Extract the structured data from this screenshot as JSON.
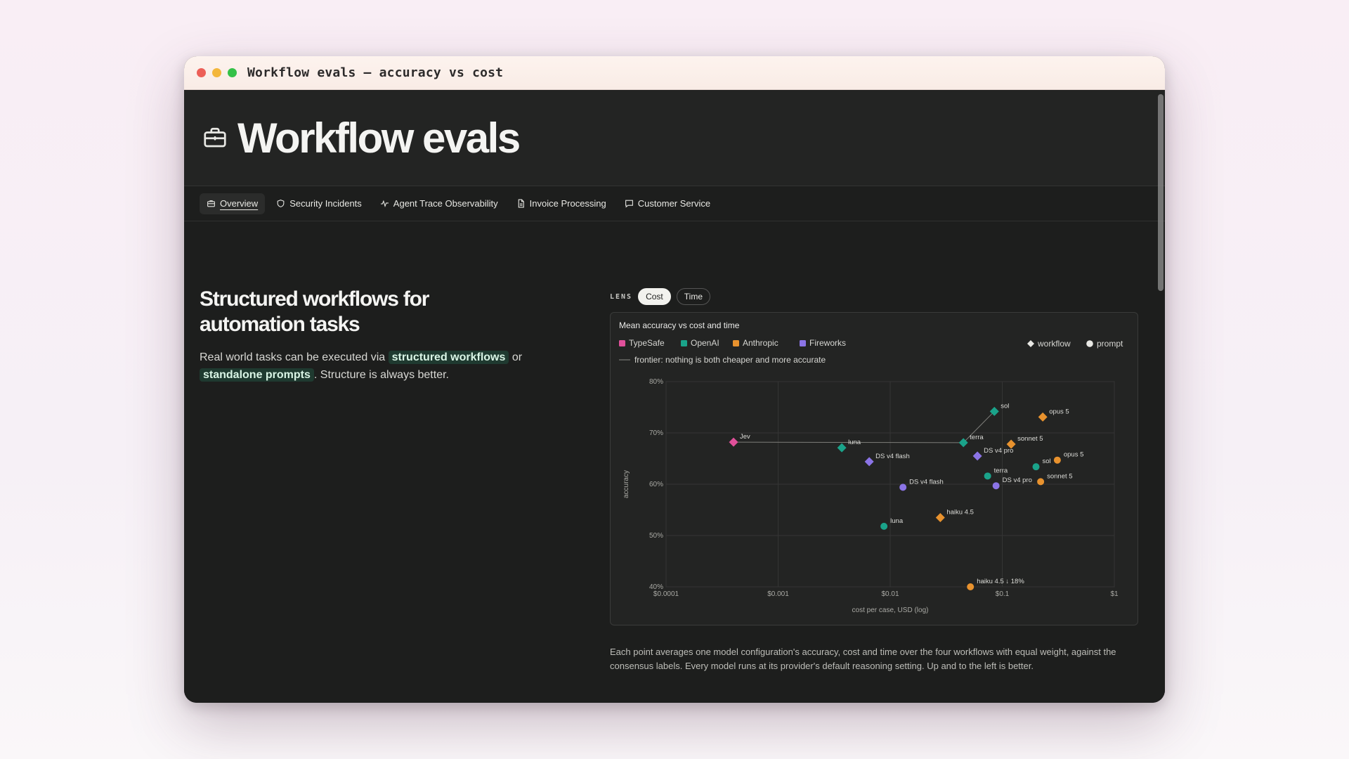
{
  "window": {
    "title": "Workflow evals — accuracy vs cost"
  },
  "header": {
    "title": "Workflow evals"
  },
  "tabs": [
    {
      "label": "Overview",
      "icon": "briefcase-icon",
      "active": true
    },
    {
      "label": "Security Incidents",
      "icon": "shield-icon",
      "active": false
    },
    {
      "label": "Agent Trace Observability",
      "icon": "activity-icon",
      "active": false
    },
    {
      "label": "Invoice Processing",
      "icon": "document-icon",
      "active": false
    },
    {
      "label": "Customer Service",
      "icon": "chat-icon",
      "active": false
    }
  ],
  "intro": {
    "heading_line1": "Structured workflows for",
    "heading_line2": "automation tasks",
    "text_before": "Real world tasks can be executed via",
    "highlight1": "structured workflows",
    "text_middle": "or",
    "highlight2": "standalone prompts",
    "text_after": ". Structure is always better."
  },
  "lens": {
    "label": "LENS",
    "options": [
      "Cost",
      "Time"
    ],
    "selected": "Cost"
  },
  "caption": "Each point averages one model configuration's accuracy, cost and time over the four workflows with equal weight, against the consensus labels. Every model runs at its provider's default reasoning setting. Up and to the left is better.",
  "colors": {
    "TypeSafe": "#e0509a",
    "OpenAI": "#1aa38a",
    "Anthropic": "#e8922e",
    "Fireworks": "#8b74e6"
  },
  "chart_data": {
    "type": "scatter",
    "title": "Mean accuracy vs cost and time",
    "xlabel": "cost per case, USD (log)",
    "ylabel": "accuracy",
    "xscale": "log",
    "xlim": [
      0.0001,
      1
    ],
    "ylim": [
      40,
      80
    ],
    "xticks": [
      {
        "v": 0.0001,
        "label": "$0.0001"
      },
      {
        "v": 0.001,
        "label": "$0.001"
      },
      {
        "v": 0.01,
        "label": "$0.01"
      },
      {
        "v": 0.1,
        "label": "$0.1"
      },
      {
        "v": 1,
        "label": "$1"
      }
    ],
    "yticks": [
      {
        "v": 40,
        "label": "40%"
      },
      {
        "v": 50,
        "label": "50%"
      },
      {
        "v": 60,
        "label": "60%"
      },
      {
        "v": 70,
        "label": "70%"
      },
      {
        "v": 80,
        "label": "80%"
      }
    ],
    "grid": true,
    "legend_position": "top",
    "legend_providers": [
      "TypeSafe",
      "OpenAI",
      "Anthropic",
      "Fireworks"
    ],
    "legend_shapes": [
      {
        "shape": "diamond",
        "label": "workflow"
      },
      {
        "shape": "circle",
        "label": "prompt"
      }
    ],
    "frontier_label": "frontier: nothing is both cheaper and more accurate",
    "frontier": [
      "Jev",
      "terra-workflow",
      "sol-workflow"
    ],
    "points": [
      {
        "id": "Jev",
        "label": "Jev",
        "provider": "TypeSafe",
        "shape": "diamond",
        "x": 0.0004,
        "y": 68.2
      },
      {
        "id": "luna-workflow",
        "label": "luna",
        "provider": "OpenAI",
        "shape": "diamond",
        "x": 0.0037,
        "y": 67.1
      },
      {
        "id": "dsflash-workflow",
        "label": "DS v4 flash",
        "provider": "Fireworks",
        "shape": "diamond",
        "x": 0.0065,
        "y": 64.4
      },
      {
        "id": "terra-workflow",
        "label": "terra",
        "provider": "OpenAI",
        "shape": "diamond",
        "x": 0.045,
        "y": 68.1
      },
      {
        "id": "dspro-workflow",
        "label": "DS v4 pro",
        "provider": "Fireworks",
        "shape": "diamond",
        "x": 0.06,
        "y": 65.5
      },
      {
        "id": "sol-workflow",
        "label": "sol",
        "provider": "OpenAI",
        "shape": "diamond",
        "x": 0.085,
        "y": 74.2
      },
      {
        "id": "opus-workflow",
        "label": "opus 5",
        "provider": "Anthropic",
        "shape": "diamond",
        "x": 0.23,
        "y": 73.1
      },
      {
        "id": "sonnet-workflow",
        "label": "sonnet 5",
        "provider": "Anthropic",
        "shape": "diamond",
        "x": 0.12,
        "y": 67.8
      },
      {
        "id": "haiku-workflow",
        "label": "haiku 4.5",
        "provider": "Anthropic",
        "shape": "diamond",
        "x": 0.028,
        "y": 53.5
      },
      {
        "id": "dsflash-prompt",
        "label": "DS v4 flash",
        "provider": "Fireworks",
        "shape": "circle",
        "x": 0.013,
        "y": 59.4
      },
      {
        "id": "luna-prompt",
        "label": "luna",
        "provider": "OpenAI",
        "shape": "circle",
        "x": 0.0088,
        "y": 51.8
      },
      {
        "id": "terra-prompt",
        "label": "terra",
        "provider": "OpenAI",
        "shape": "circle",
        "x": 0.074,
        "y": 61.6
      },
      {
        "id": "dspro-prompt",
        "label": "DS v4 pro",
        "provider": "Fireworks",
        "shape": "circle",
        "x": 0.088,
        "y": 59.7
      },
      {
        "id": "sol-prompt",
        "label": "sol",
        "provider": "OpenAI",
        "shape": "circle",
        "x": 0.2,
        "y": 63.4
      },
      {
        "id": "opus-prompt",
        "label": "opus 5",
        "provider": "Anthropic",
        "shape": "circle",
        "x": 0.31,
        "y": 64.7
      },
      {
        "id": "sonnet-prompt",
        "label": "sonnet 5",
        "provider": "Anthropic",
        "shape": "circle",
        "x": 0.22,
        "y": 60.5
      },
      {
        "id": "haiku-prompt",
        "label": "haiku 4.5 ↓ 18%",
        "provider": "Anthropic",
        "shape": "circle",
        "x": 0.052,
        "y": 40
      }
    ]
  }
}
